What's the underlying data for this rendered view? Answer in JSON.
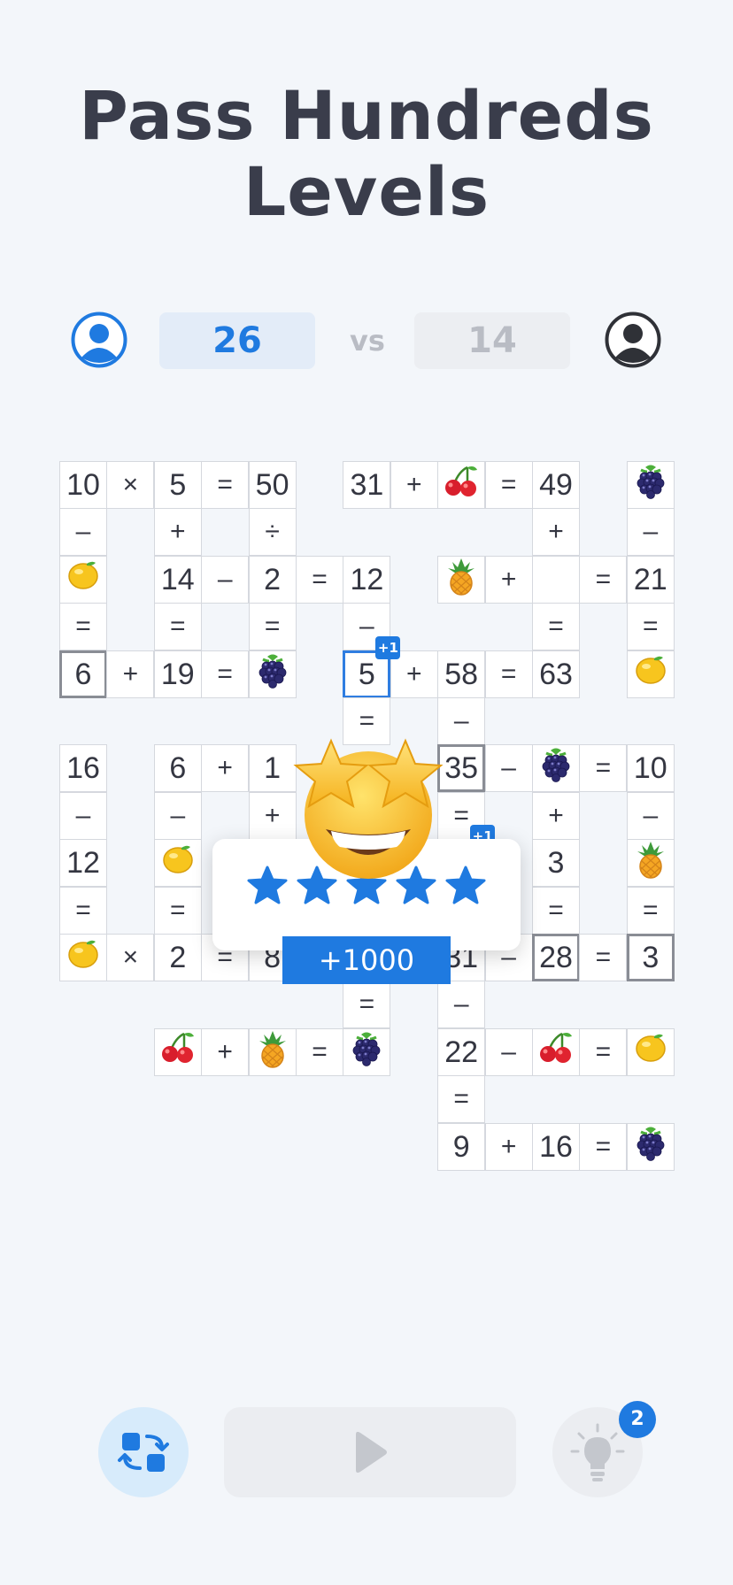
{
  "header": {
    "title_line1": "Pass Hundreds",
    "title_line2": "Levels"
  },
  "match": {
    "player_score": "26",
    "vs": "vs",
    "opponent_score": "14"
  },
  "colors": {
    "accent": "#1f7ae0",
    "text": "#3a3d4b",
    "cell_border": "#d5d8de"
  },
  "board": {
    "cells": [
      {
        "r": 0,
        "c": 0,
        "t": "10"
      },
      {
        "r": 0,
        "c": 1,
        "t": "×"
      },
      {
        "r": 0,
        "c": 2,
        "t": "5"
      },
      {
        "r": 0,
        "c": 3,
        "t": "="
      },
      {
        "r": 0,
        "c": 4,
        "t": "50"
      },
      {
        "r": 0,
        "c": 6,
        "t": "31"
      },
      {
        "r": 0,
        "c": 7,
        "t": "+"
      },
      {
        "r": 0,
        "c": 8,
        "f": "cherry"
      },
      {
        "r": 0,
        "c": 9,
        "t": "="
      },
      {
        "r": 0,
        "c": 10,
        "t": "49"
      },
      {
        "r": 0,
        "c": 12,
        "f": "blackberry"
      },
      {
        "r": 1,
        "c": 0,
        "t": "–"
      },
      {
        "r": 1,
        "c": 2,
        "t": "+"
      },
      {
        "r": 1,
        "c": 4,
        "t": "÷"
      },
      {
        "r": 1,
        "c": 10,
        "t": "+"
      },
      {
        "r": 1,
        "c": 12,
        "t": "–"
      },
      {
        "r": 2,
        "c": 0,
        "f": "lemon"
      },
      {
        "r": 2,
        "c": 2,
        "t": "14"
      },
      {
        "r": 2,
        "c": 3,
        "t": "–"
      },
      {
        "r": 2,
        "c": 4,
        "t": "2"
      },
      {
        "r": 2,
        "c": 5,
        "t": "="
      },
      {
        "r": 2,
        "c": 6,
        "t": "12"
      },
      {
        "r": 2,
        "c": 8,
        "f": "pineapple"
      },
      {
        "r": 2,
        "c": 9,
        "t": "+"
      },
      {
        "r": 2,
        "c": 10,
        "t": ""
      },
      {
        "r": 2,
        "c": 11,
        "t": "="
      },
      {
        "r": 2,
        "c": 12,
        "t": "21"
      },
      {
        "r": 3,
        "c": 0,
        "t": "="
      },
      {
        "r": 3,
        "c": 2,
        "t": "="
      },
      {
        "r": 3,
        "c": 4,
        "t": "="
      },
      {
        "r": 3,
        "c": 6,
        "t": "–"
      },
      {
        "r": 3,
        "c": 10,
        "t": "="
      },
      {
        "r": 3,
        "c": 12,
        "t": "="
      },
      {
        "r": 4,
        "c": 0,
        "t": "6",
        "s": "bx"
      },
      {
        "r": 4,
        "c": 1,
        "t": "+"
      },
      {
        "r": 4,
        "c": 2,
        "t": "19"
      },
      {
        "r": 4,
        "c": 3,
        "t": "="
      },
      {
        "r": 4,
        "c": 4,
        "f": "blackberry"
      },
      {
        "r": 4,
        "c": 6,
        "t": "5",
        "s": "sel"
      },
      {
        "r": 4,
        "c": 7,
        "t": "+"
      },
      {
        "r": 4,
        "c": 8,
        "t": "58"
      },
      {
        "r": 4,
        "c": 9,
        "t": "="
      },
      {
        "r": 4,
        "c": 10,
        "t": "63"
      },
      {
        "r": 4,
        "c": 12,
        "f": "lemon"
      },
      {
        "r": 5,
        "c": 6,
        "t": "="
      },
      {
        "r": 5,
        "c": 8,
        "t": "–"
      },
      {
        "r": 6,
        "c": 0,
        "t": "16"
      },
      {
        "r": 6,
        "c": 2,
        "t": "6"
      },
      {
        "r": 6,
        "c": 3,
        "t": "+"
      },
      {
        "r": 6,
        "c": 4,
        "t": "1"
      },
      {
        "r": 6,
        "c": 8,
        "t": "35",
        "s": "bx"
      },
      {
        "r": 6,
        "c": 9,
        "t": "–"
      },
      {
        "r": 6,
        "c": 10,
        "f": "blackberry"
      },
      {
        "r": 6,
        "c": 11,
        "t": "="
      },
      {
        "r": 6,
        "c": 12,
        "t": "10"
      },
      {
        "r": 7,
        "c": 0,
        "t": "–"
      },
      {
        "r": 7,
        "c": 2,
        "t": "–"
      },
      {
        "r": 7,
        "c": 4,
        "t": "+"
      },
      {
        "r": 7,
        "c": 8,
        "t": "="
      },
      {
        "r": 7,
        "c": 10,
        "t": "+"
      },
      {
        "r": 7,
        "c": 12,
        "t": "–"
      },
      {
        "r": 8,
        "c": 0,
        "t": "12"
      },
      {
        "r": 8,
        "c": 2,
        "f": "lemon"
      },
      {
        "r": 8,
        "c": 10,
        "t": "3"
      },
      {
        "r": 8,
        "c": 12,
        "f": "pineapple"
      },
      {
        "r": 9,
        "c": 0,
        "t": "="
      },
      {
        "r": 9,
        "c": 2,
        "t": "="
      },
      {
        "r": 9,
        "c": 10,
        "t": "="
      },
      {
        "r": 9,
        "c": 12,
        "t": "="
      },
      {
        "r": 10,
        "c": 0,
        "f": "lemon"
      },
      {
        "r": 10,
        "c": 1,
        "t": "×"
      },
      {
        "r": 10,
        "c": 2,
        "t": "2"
      },
      {
        "r": 10,
        "c": 3,
        "t": "="
      },
      {
        "r": 10,
        "c": 4,
        "t": "8"
      },
      {
        "r": 10,
        "c": 8,
        "t": "31"
      },
      {
        "r": 10,
        "c": 9,
        "t": "–"
      },
      {
        "r": 10,
        "c": 10,
        "t": "28",
        "s": "bx"
      },
      {
        "r": 10,
        "c": 11,
        "t": "="
      },
      {
        "r": 10,
        "c": 12,
        "t": "3",
        "s": "bx"
      },
      {
        "r": 11,
        "c": 6,
        "t": "="
      },
      {
        "r": 11,
        "c": 8,
        "t": "–"
      },
      {
        "r": 12,
        "c": 2,
        "f": "cherry"
      },
      {
        "r": 12,
        "c": 3,
        "t": "+"
      },
      {
        "r": 12,
        "c": 4,
        "f": "pineapple"
      },
      {
        "r": 12,
        "c": 5,
        "t": "="
      },
      {
        "r": 12,
        "c": 6,
        "f": "blackberry"
      },
      {
        "r": 12,
        "c": 8,
        "t": "22"
      },
      {
        "r": 12,
        "c": 9,
        "t": "–"
      },
      {
        "r": 12,
        "c": 10,
        "f": "cherry"
      },
      {
        "r": 12,
        "c": 11,
        "t": "="
      },
      {
        "r": 12,
        "c": 12,
        "f": "lemon"
      },
      {
        "r": 13,
        "c": 8,
        "t": "="
      },
      {
        "r": 14,
        "c": 8,
        "t": "9"
      },
      {
        "r": 14,
        "c": 9,
        "t": "+"
      },
      {
        "r": 14,
        "c": 10,
        "t": "16"
      },
      {
        "r": 14,
        "c": 11,
        "t": "="
      },
      {
        "r": 14,
        "c": 12,
        "f": "blackberry"
      }
    ],
    "plus_badges": [
      {
        "r": 4,
        "c": 6,
        "label": "+1"
      },
      {
        "r": 8,
        "c": 8,
        "label": "+1"
      }
    ]
  },
  "reward_popup": {
    "stars": 5,
    "reward": "+1000",
    "emoji": "star-struck-emoji"
  },
  "controls": {
    "swap": "swap-icon",
    "play": "play-icon",
    "hint": "lightbulb-icon",
    "hint_count": "2"
  }
}
